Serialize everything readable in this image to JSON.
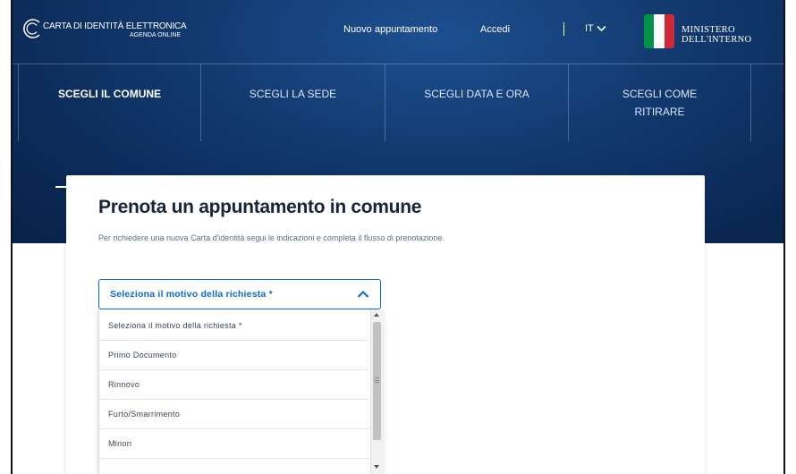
{
  "header": {
    "brand_title": "CARTA DI IDENTITÀ ELETTRONICA",
    "brand_subtitle": "AGENDA ONLINE",
    "nav_new_appointment": "Nuovo appuntamento",
    "nav_login": "Accedi",
    "language": "IT",
    "ministry_line1": "MINISTERO",
    "ministry_line2": "DELL'INTERNO",
    "flag_colors": [
      "#009246",
      "#ffffff",
      "#ce2b37"
    ]
  },
  "steps": [
    {
      "label": "SCEGLI IL COMUNE",
      "active": true
    },
    {
      "label": "SCEGLI LA SEDE",
      "active": false
    },
    {
      "label": "SCEGLI DATA E ORA",
      "active": false
    },
    {
      "label_line1": "SCEGLI COME",
      "label_line2": "RITIRARE",
      "active": false
    }
  ],
  "card": {
    "title": "Prenota un appuntamento in comune",
    "description": "Per richiedere una nuova Carta d'identità segui le indicazioni e completa il flusso di prenotazione."
  },
  "select": {
    "label": "Seleziona il motivo della richiesta *",
    "expanded": true,
    "options": [
      "Seleziona il motivo della richiesta *",
      "Primo Documento",
      "Rinnovo",
      "Furto/Smarrimento",
      "Minori"
    ]
  },
  "colors": {
    "hero_blue": "#123a70",
    "accent": "#0b6bd1",
    "title_text": "#17243a"
  }
}
